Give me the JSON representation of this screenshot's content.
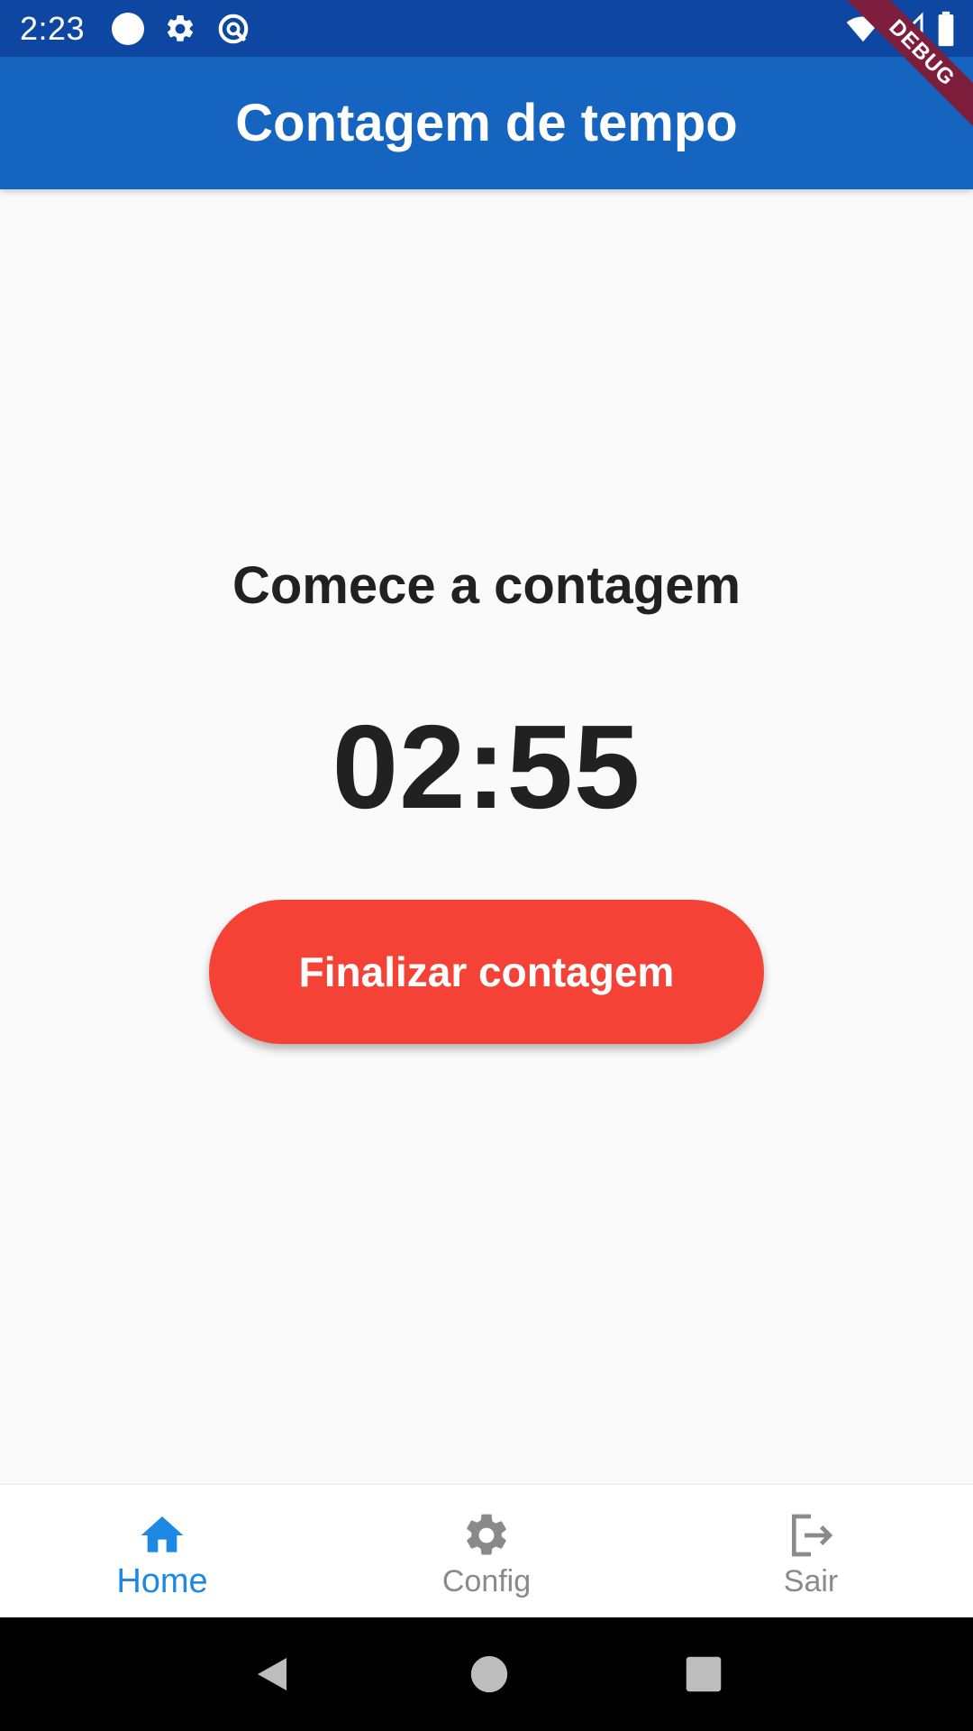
{
  "status_bar": {
    "time": "2:23",
    "icons_left": [
      "circle-icon",
      "gear-icon",
      "data-saver-icon"
    ],
    "icons_right": [
      "wifi-icon",
      "signal-icon",
      "battery-icon"
    ]
  },
  "debug_banner": "DEBUG",
  "app_bar": {
    "title": "Contagem de tempo"
  },
  "main": {
    "heading": "Comece a contagem",
    "timer": "02:55",
    "finish_button_label": "Finalizar contagem"
  },
  "bottom_nav": {
    "items": [
      {
        "label": "Home",
        "icon": "home-icon",
        "active": true
      },
      {
        "label": "Config",
        "icon": "gear-icon",
        "active": false
      },
      {
        "label": "Sair",
        "icon": "logout-icon",
        "active": false
      }
    ]
  },
  "colors": {
    "status_bar": "#0d47a1",
    "app_bar": "#1565c0",
    "button": "#f44336",
    "active_nav": "#1e88e5",
    "inactive_nav": "#8a8a8a",
    "background": "#fafafa"
  },
  "system_nav": [
    "back-icon",
    "home-circle-icon",
    "recents-icon"
  ]
}
